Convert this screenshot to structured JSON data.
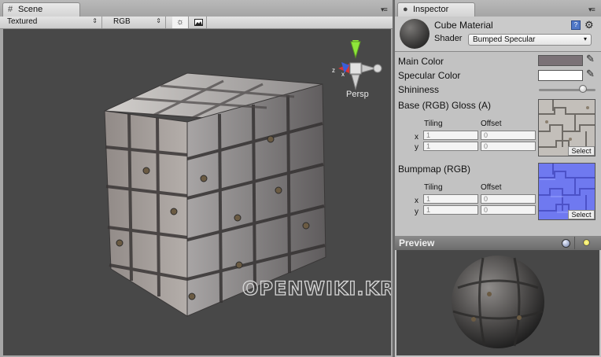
{
  "scene": {
    "tab_label": "Scene",
    "tab_menu": "▾≡",
    "render_mode": "Textured",
    "channel": "RGB",
    "gizmo": {
      "label": "Persp",
      "x_axis": "x",
      "z_axis": "z"
    },
    "watermark": "OPENWIKI.KR"
  },
  "inspector": {
    "tab_label": "Inspector",
    "tab_menu": "▾≡",
    "material_name": "Cube Material",
    "shader_label": "Shader",
    "shader_value": "Bumped Specular",
    "properties": {
      "main_color_label": "Main Color",
      "main_color": "#7b7277",
      "specular_color_label": "Specular Color",
      "specular_color": "#ffffff",
      "shininess_label": "Shininess",
      "shininess": 0.78
    },
    "base_texture": {
      "title": "Base (RGB) Gloss (A)",
      "tiling_label": "Tiling",
      "offset_label": "Offset",
      "x_label": "x",
      "y_label": "y",
      "tiling_x": "1",
      "tiling_y": "1",
      "offset_x": "0",
      "offset_y": "0",
      "select_label": "Select"
    },
    "bump_texture": {
      "title": "Bumpmap (RGB)",
      "tiling_label": "Tiling",
      "offset_label": "Offset",
      "x_label": "x",
      "y_label": "y",
      "tiling_x": "1",
      "tiling_y": "1",
      "offset_x": "0",
      "offset_y": "0",
      "select_label": "Select"
    }
  },
  "preview": {
    "title": "Preview"
  },
  "colors": {
    "viewport_bg": "#484848",
    "preview_bg": "#474747",
    "normal_map": "#6f79f0",
    "gizmo_y": "#8ee63a",
    "gizmo_x": "#d83434",
    "gizmo_z": "#3a5ed8"
  }
}
